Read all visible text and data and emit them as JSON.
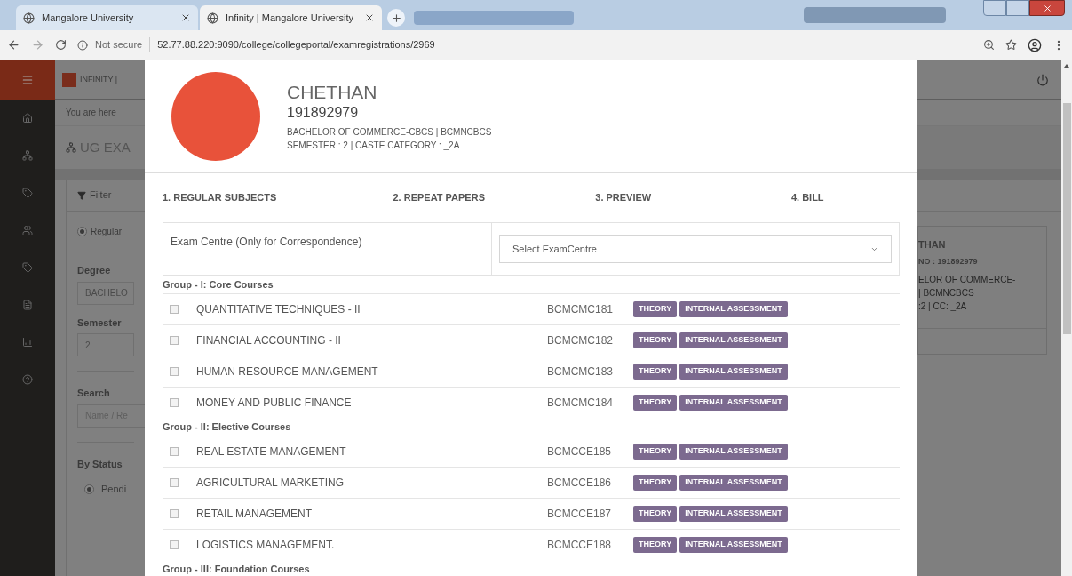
{
  "browser": {
    "tabs": [
      {
        "title": "Mangalore University",
        "selected": false
      },
      {
        "title": "Infinity | Mangalore University",
        "selected": true
      }
    ],
    "security": "Not secure",
    "url": "52.77.88.220:9090/college/collegeportal/examregistrations/2969"
  },
  "background": {
    "brand": "INFINITY |",
    "breadcrumb": "You are here",
    "page_title": "UG EXA",
    "filter": "Filter",
    "type_radio": {
      "label": "Regular",
      "selected": true
    },
    "degree": {
      "label": "Degree",
      "value": "BACHELO"
    },
    "semester": {
      "label": "Semester",
      "value": "2"
    },
    "search": {
      "label": "Search",
      "placeholder": "Name / Re"
    },
    "status": {
      "label": "By Status",
      "option": "Pendi",
      "selected": true
    },
    "card": [
      "THAN",
      "NO : 191892979",
      "ELOR OF COMMERCE-",
      "| BCMNCBCS",
      ":2 | CC: _2A"
    ]
  },
  "student": {
    "name": "CHETHAN",
    "id": "191892979",
    "program": "BACHELOR OF COMMERCE-CBCS | BCMNCBCS",
    "details": "SEMESTER : 2 | CASTE CATEGORY : _2A"
  },
  "steps": [
    "1. REGULAR SUBJECTS",
    "2. REPEAT PAPERS",
    "3. PREVIEW",
    "4. BILL"
  ],
  "exam_centre": {
    "label": "Exam Centre (Only for Correspondence)",
    "placeholder": "Select ExamCentre"
  },
  "groups": [
    {
      "title": "Group - I: Core Courses",
      "subjects": [
        {
          "name": "QUANTITATIVE TECHNIQUES - II",
          "code": "BCMCMC181",
          "checked": false,
          "tags": [
            "THEORY",
            "INTERNAL ASSESSMENT"
          ]
        },
        {
          "name": "FINANCIAL ACCOUNTING - II",
          "code": "BCMCMC182",
          "checked": false,
          "tags": [
            "THEORY",
            "INTERNAL ASSESSMENT"
          ]
        },
        {
          "name": "HUMAN RESOURCE MANAGEMENT",
          "code": "BCMCMC183",
          "checked": false,
          "tags": [
            "THEORY",
            "INTERNAL ASSESSMENT"
          ]
        },
        {
          "name": "MONEY AND PUBLIC FINANCE",
          "code": "BCMCMC184",
          "checked": false,
          "tags": [
            "THEORY",
            "INTERNAL ASSESSMENT"
          ]
        }
      ]
    },
    {
      "title": "Group - II: Elective Courses",
      "subjects": [
        {
          "name": "REAL ESTATE MANAGEMENT",
          "code": "BCMCCE185",
          "checked": false,
          "tags": [
            "THEORY",
            "INTERNAL ASSESSMENT"
          ]
        },
        {
          "name": "AGRICULTURAL MARKETING",
          "code": "BCMCCE186",
          "checked": false,
          "tags": [
            "THEORY",
            "INTERNAL ASSESSMENT"
          ]
        },
        {
          "name": "RETAIL MANAGEMENT",
          "code": "BCMCCE187",
          "checked": false,
          "tags": [
            "THEORY",
            "INTERNAL ASSESSMENT"
          ]
        },
        {
          "name": "LOGISTICS MANAGEMENT.",
          "code": "BCMCCE188",
          "checked": false,
          "tags": [
            "THEORY",
            "INTERNAL ASSESSMENT"
          ]
        }
      ]
    },
    {
      "title": "Group - III: Foundation Courses"
    }
  ]
}
